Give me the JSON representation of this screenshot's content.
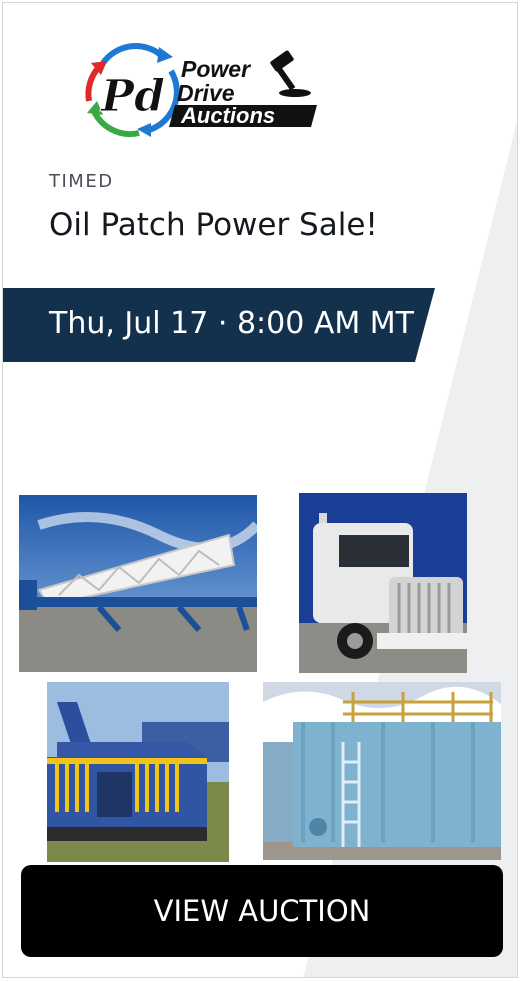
{
  "brand": {
    "logo_monogram": "Pd",
    "logo_line1": "Power",
    "logo_line2": "Drive",
    "logo_line3": "Auctions",
    "navy_color": "#13304d",
    "accent_red": "#e02a2a",
    "accent_green": "#3aa844",
    "accent_blue": "#1f78d1"
  },
  "event": {
    "type_label": "TIMED",
    "title": "Oil Patch Power Sale!",
    "date_text": "Thu, Jul 17 · 8:00 AM MT"
  },
  "gallery": {
    "photos": [
      "trailer-photo",
      "truck-photo",
      "rig-equipment-photo",
      "tank-photo"
    ]
  },
  "cta": {
    "label": "VIEW AUCTION"
  }
}
